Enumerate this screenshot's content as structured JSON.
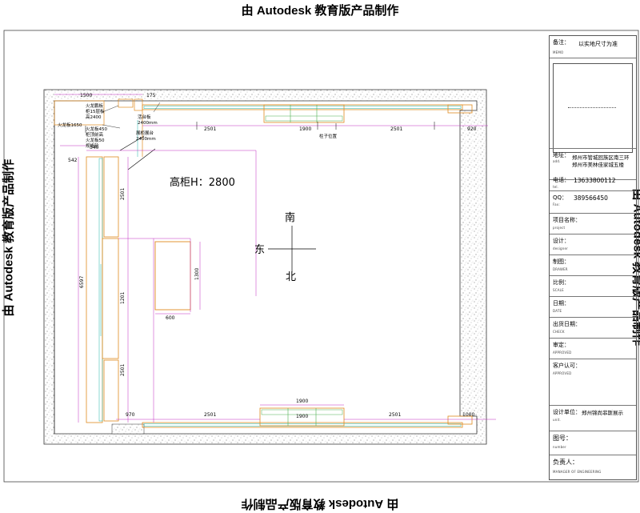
{
  "watermark": {
    "text": "由 Autodesk 教育版产品制作"
  },
  "plan": {
    "height_label": "高柜H：2800",
    "compass": {
      "south": "南",
      "east": "东",
      "north": "北"
    },
    "dimensions": {
      "top_left_1": "1500",
      "top_left_2": "175",
      "top_segment_1": "2501",
      "top_middle": "1900",
      "top_segment_2": "2501",
      "top_right": "920",
      "left_542": "542",
      "left_340": "340",
      "left_total": "6597",
      "left_upper": "2501",
      "left_middle": "1201",
      "left_lower": "2501",
      "island_width": "600",
      "island_depth": "1300",
      "bottom_left": "970",
      "bottom_segment_1": "2501",
      "bottom_middle_top": "1900",
      "bottom_middle": "1900",
      "bottom_segment_2": "2501",
      "bottom_right": "1000"
    },
    "notes": {
      "top_left_a": "火龙鹏板",
      "top_left_b": "柜15层板",
      "top_left_c": "高2400",
      "top_left_d": "火龙板1650",
      "top_left_e": "火龙板450",
      "top_left_f": "柜顶前高",
      "top_left_g": "火龙板50",
      "top_left_h": "规格轮",
      "top_center_a": "活台板",
      "top_center_b": "2400mm",
      "middle_top_a": "展柜展台",
      "middle_top_b": "2400mm",
      "column_note": "柱子位置"
    }
  },
  "title_block": {
    "memo_label": "备注：",
    "memo_label_en": "MEMO",
    "memo_value": "以实地尺寸为准",
    "address_label": "地址：",
    "address_label_en": "add.",
    "address_line1": "郑州市管城回族区南三环",
    "address_line2": "郑州市美林佳家城五楼",
    "tel_label": "电话：",
    "tel_label_en": "tel.",
    "tel_value": "13633800112",
    "qq_label": "QQ：",
    "qq_label_en": "Fax:",
    "qq_value": "389566450",
    "project_label": "项目名称：",
    "project_label_en": "project",
    "designer_label": "设计：",
    "designer_label_en": "designer",
    "drawer_label": "制图：",
    "drawer_label_en": "DRAWER",
    "scale_label": "比例：",
    "scale_label_en": "SCALE",
    "date_label": "日期：",
    "date_label_en": "DATE",
    "issue_label": "出货日期：",
    "issue_label_en": "CHECK",
    "review_label": "审定：",
    "review_label_en": "APPROVED",
    "client_label": "客户认可：",
    "client_label_en": "APPROVED",
    "unit_label": "设计单位：",
    "unit_label_en": "unit.",
    "unit_value": "郑州锦尚菲斯展示",
    "number_label": "图号：",
    "number_label_en": "number",
    "owner_label": "负责人：",
    "owner_label_en": "MANAGER OF ENGINEERING"
  }
}
